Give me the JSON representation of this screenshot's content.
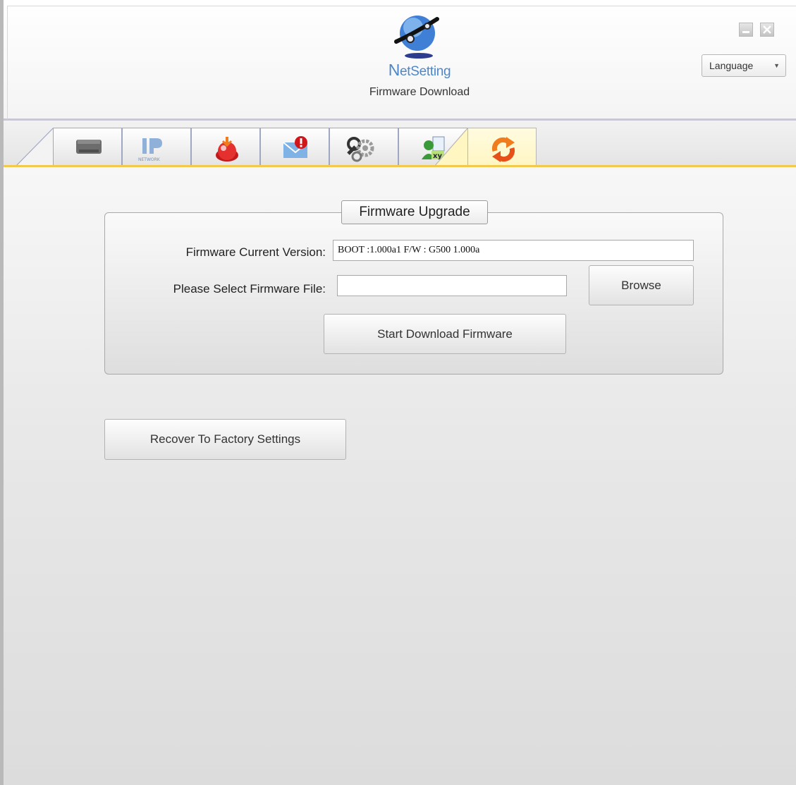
{
  "header": {
    "logo_text_first": "N",
    "logo_text_rest": "etSetting",
    "page_title": "Firmware Download",
    "language_label": "Language"
  },
  "tabs": [
    {
      "name": "printer-tab",
      "icon": "printer-icon",
      "active": false
    },
    {
      "name": "ip-network-tab",
      "icon": "ip-network-icon",
      "icon_text": "IP",
      "icon_subtext": "NETWORK",
      "active": false
    },
    {
      "name": "alert-tab",
      "icon": "alert-button-icon",
      "active": false
    },
    {
      "name": "email-alert-tab",
      "icon": "email-alert-icon",
      "active": false
    },
    {
      "name": "settings-tab",
      "icon": "gears-icon",
      "active": false
    },
    {
      "name": "user-config-tab",
      "icon": "user-config-icon",
      "icon_text": "xy",
      "active": false
    },
    {
      "name": "firmware-tab",
      "icon": "refresh-arrows-icon",
      "active": true
    }
  ],
  "firmware": {
    "group_title": "Firmware Upgrade",
    "current_version_label": "Firmware Current Version:",
    "current_version_value": "BOOT :1.000a1  F/W : G500 1.000a",
    "select_file_label": "Please Select Firmware File:",
    "select_file_value": "",
    "browse_label": "Browse",
    "start_download_label": "Start Download Firmware"
  },
  "recover_label": "Recover To Factory  Settings",
  "colors": {
    "accent_tab_line": "#f2c94c",
    "logo_blue": "#4d87c7",
    "active_tab": "#fff6c2",
    "refresh_orange": "#f07c1d"
  }
}
